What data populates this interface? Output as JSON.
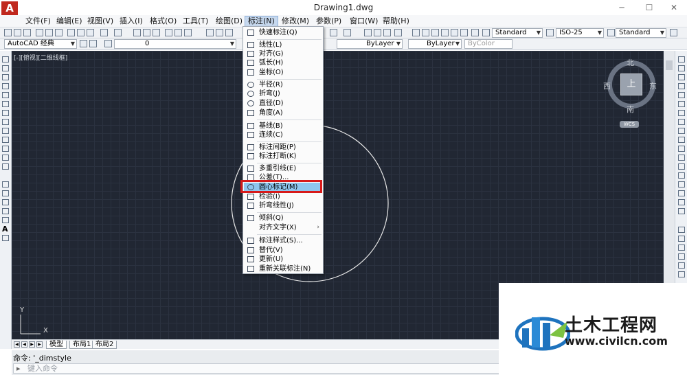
{
  "window": {
    "title": "Drawing1.dwg",
    "logo_letter": "A"
  },
  "menubar": [
    {
      "label": "文件(F)"
    },
    {
      "label": "编辑(E)"
    },
    {
      "label": "视图(V)"
    },
    {
      "label": "插入(I)"
    },
    {
      "label": "格式(O)"
    },
    {
      "label": "工具(T)"
    },
    {
      "label": "绘图(D)"
    },
    {
      "label": "标注(N)"
    },
    {
      "label": "修改(M)"
    },
    {
      "label": "参数(P)"
    },
    {
      "label": "窗口(W)"
    },
    {
      "label": "帮助(H)"
    }
  ],
  "toolbar": {
    "text_style": "Standard",
    "dim_style": "ISO-25",
    "table_style": "Standard",
    "workspace": "AutoCAD 经典",
    "layer": "0",
    "linetype": "ByLayer",
    "lineweight": "ByLayer",
    "plotstyle": "ByColor"
  },
  "viewport_label": "[-][俯视][二维线框]",
  "compass": {
    "north": "北",
    "south": "南",
    "east": "东",
    "west": "西",
    "top": "上",
    "wcs": "WCS"
  },
  "ucs": {
    "x": "X",
    "y": "Y"
  },
  "dim_menu": {
    "items": [
      {
        "label": "快速标注(Q)"
      },
      {
        "label": "线性(L)"
      },
      {
        "label": "对齐(G)"
      },
      {
        "label": "弧长(H)"
      },
      {
        "label": "坐标(O)"
      },
      {
        "label": "半径(R)"
      },
      {
        "label": "折弯(J)"
      },
      {
        "label": "直径(D)"
      },
      {
        "label": "角度(A)"
      },
      {
        "label": "基线(B)"
      },
      {
        "label": "连续(C)"
      },
      {
        "label": "标注间距(P)"
      },
      {
        "label": "标注打断(K)"
      },
      {
        "label": "多重引线(E)"
      },
      {
        "label": "公差(T)..."
      },
      {
        "label": "圆心标记(M)"
      },
      {
        "label": "检验(I)"
      },
      {
        "label": "折弯线性(J)"
      },
      {
        "label": "倾斜(Q)"
      },
      {
        "label": "对齐文字(X)",
        "submenu": "›"
      },
      {
        "label": "标注样式(S)..."
      },
      {
        "label": "替代(V)"
      },
      {
        "label": "更新(U)"
      },
      {
        "label": "重新关联标注(N)"
      }
    ]
  },
  "tabs": [
    {
      "label": "模型"
    },
    {
      "label": "布局1"
    },
    {
      "label": "布局2"
    }
  ],
  "command": {
    "history": "命令: '_dimstyle",
    "placeholder": "键入命令"
  },
  "watermark": {
    "name": "土木工程网",
    "url": "www.civilcn.com"
  }
}
